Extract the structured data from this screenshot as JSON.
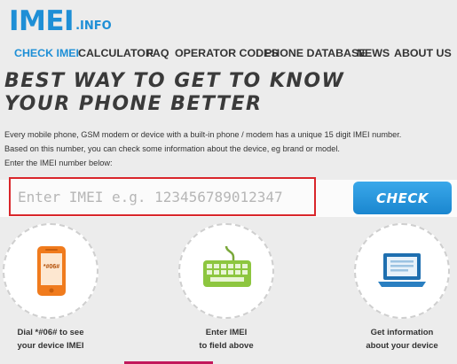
{
  "logo": {
    "main": "IMEI",
    "suffix": ".INFO"
  },
  "nav": {
    "items": [
      "CHECK IMEI",
      "CALCULATOR",
      "FAQ",
      "OPERATOR CODES",
      "PHONE DATABASE",
      "NEWS",
      "ABOUT US"
    ],
    "active": "CHECK IMEI"
  },
  "headline": {
    "line1": "BEST WAY TO GET TO KNOW",
    "line2": "YOUR PHONE BETTER"
  },
  "description": {
    "line1": "Every mobile phone, GSM modem or device with a built-in phone / modem has a unique 15 digit IMEI number.",
    "line2": "Based on this number, you can check some information about the device, eg brand or model.",
    "line3": "Enter the IMEI number below:"
  },
  "search": {
    "placeholder": "Enter IMEI e.g. 123456789012347",
    "button_label": "CHECK"
  },
  "steps": [
    {
      "icon": "phone-icon",
      "phone_code": "*#06#",
      "line1": "Dial *#06# to see",
      "line2": "your device IMEI"
    },
    {
      "icon": "keyboard-icon",
      "line1": "Enter IMEI",
      "line2": "to field above"
    },
    {
      "icon": "laptop-icon",
      "line1": "Get information",
      "line2": "about your device"
    }
  ],
  "colors": {
    "accent": "#1e8fd6",
    "highlight_border": "#d9262b",
    "phone_orange": "#f07b1d",
    "keyboard_green": "#8dc63f"
  }
}
